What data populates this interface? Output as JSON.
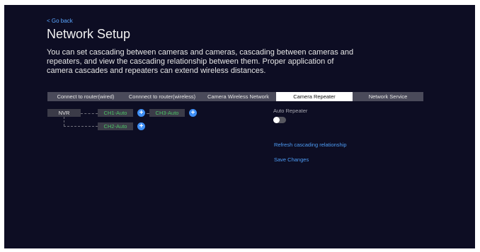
{
  "header": {
    "back_label": "< Go back",
    "title": "Network Setup",
    "description": "You can set cascading between cameras and cameras, cascading between cameras and repeaters, and view the cascading relationship between them. Proper application of camera cascades and repeaters can extend wireless distances."
  },
  "tabs": [
    {
      "label": "Connect to router(wired)"
    },
    {
      "label": "Connnect to router(wireless)"
    },
    {
      "label": "Camera Wireless Network"
    },
    {
      "label": "Camera Repeater",
      "active": true
    },
    {
      "label": "Network Service"
    }
  ],
  "topology": {
    "nvr_label": "NVR",
    "ch1_label": "CH1-Auto",
    "ch3_label": "CH3-Auto",
    "ch2_label": "CH2-Auto",
    "add_symbol": "+"
  },
  "settings": {
    "auto_repeater_label": "Auto Repeater",
    "auto_repeater_enabled": false,
    "refresh_label": "Refresh cascading relationship",
    "save_label": "Save Changes"
  },
  "colors": {
    "background": "#0d0d23",
    "accent": "#3f8ff5",
    "link": "#4d9cf5",
    "channel_text": "#4cc266",
    "tab_bar": "#4a4a5a"
  }
}
